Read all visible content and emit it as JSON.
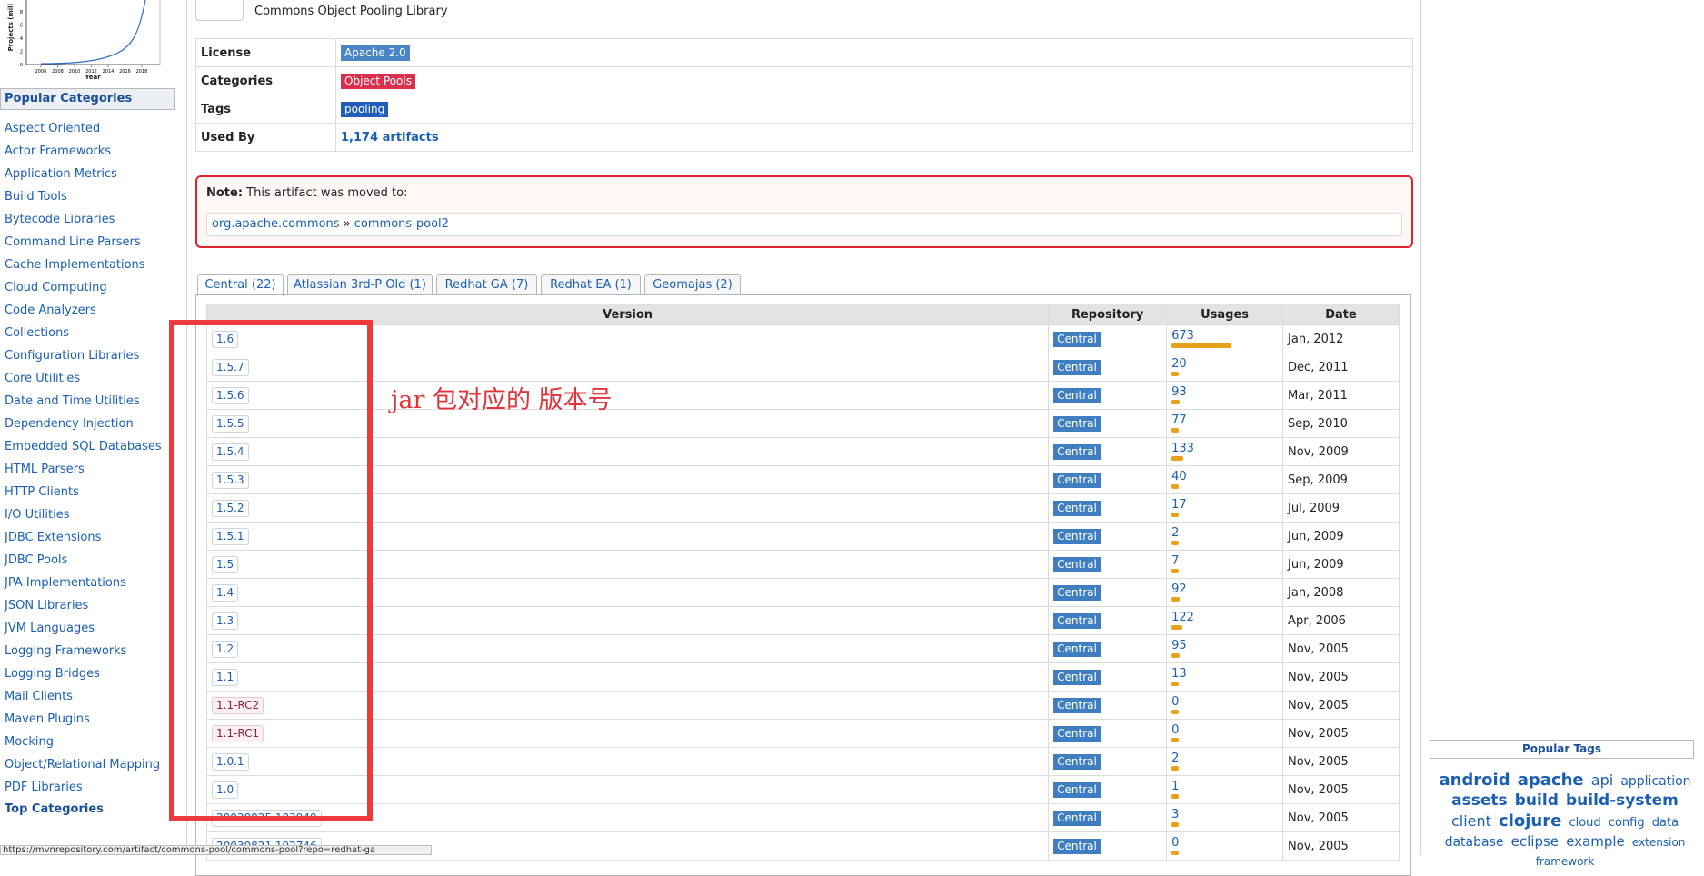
{
  "growth_chart": {
    "ylabel": "Projects (mill",
    "xlabel": "Year",
    "x_ticks": [
      "2006",
      "2008",
      "2010",
      "2012",
      "2014",
      "2016",
      "2018"
    ],
    "y_ticks": [
      "0",
      "2",
      "4",
      "6",
      "8"
    ]
  },
  "sidebar": {
    "popular_header": "Popular Categories",
    "categories": [
      "Aspect Oriented",
      "Actor Frameworks",
      "Application Metrics",
      "Build Tools",
      "Bytecode Libraries",
      "Command Line Parsers",
      "Cache Implementations",
      "Cloud Computing",
      "Code Analyzers",
      "Collections",
      "Configuration Libraries",
      "Core Utilities",
      "Date and Time Utilities",
      "Dependency Injection",
      "Embedded SQL Databases",
      "HTML Parsers",
      "HTTP Clients",
      "I/O Utilities",
      "JDBC Extensions",
      "JDBC Pools",
      "JPA Implementations",
      "JSON Libraries",
      "JVM Languages",
      "Logging Frameworks",
      "Logging Bridges",
      "Mail Clients",
      "Maven Plugins",
      "Mocking",
      "Object/Relational Mapping",
      "PDF Libraries"
    ],
    "top_categories": "Top Categories"
  },
  "artifact": {
    "description": "Commons Object Pooling Library",
    "license_key": "License",
    "license_value": "Apache 2.0",
    "categories_key": "Categories",
    "categories_value": "Object Pools",
    "tags_key": "Tags",
    "tags_value": "pooling",
    "used_by_key": "Used By",
    "used_by_value": "1,174 artifacts"
  },
  "note": {
    "label": "Note:",
    "text": " This artifact was moved to:",
    "group": "org.apache.commons",
    "separator": " » ",
    "artifact": "commons-pool2"
  },
  "tabs": [
    "Central (22)",
    "Atlassian 3rd-P Old (1)",
    "Redhat GA (7)",
    "Redhat EA (1)",
    "Geomajas (2)"
  ],
  "table": {
    "headers": [
      "Version",
      "Repository",
      "Usages",
      "Date"
    ],
    "rows": [
      {
        "version": "1.6",
        "repo": "Central",
        "usages": "673",
        "usage_value": 673,
        "date": "Jan, 2012",
        "pre": false
      },
      {
        "version": "1.5.7",
        "repo": "Central",
        "usages": "20",
        "usage_value": 20,
        "date": "Dec, 2011",
        "pre": false
      },
      {
        "version": "1.5.6",
        "repo": "Central",
        "usages": "93",
        "usage_value": 93,
        "date": "Mar, 2011",
        "pre": false
      },
      {
        "version": "1.5.5",
        "repo": "Central",
        "usages": "77",
        "usage_value": 77,
        "date": "Sep, 2010",
        "pre": false
      },
      {
        "version": "1.5.4",
        "repo": "Central",
        "usages": "133",
        "usage_value": 133,
        "date": "Nov, 2009",
        "pre": false
      },
      {
        "version": "1.5.3",
        "repo": "Central",
        "usages": "40",
        "usage_value": 40,
        "date": "Sep, 2009",
        "pre": false
      },
      {
        "version": "1.5.2",
        "repo": "Central",
        "usages": "17",
        "usage_value": 17,
        "date": "Jul, 2009",
        "pre": false
      },
      {
        "version": "1.5.1",
        "repo": "Central",
        "usages": "2",
        "usage_value": 2,
        "date": "Jun, 2009",
        "pre": false
      },
      {
        "version": "1.5",
        "repo": "Central",
        "usages": "7",
        "usage_value": 7,
        "date": "Jun, 2009",
        "pre": false
      },
      {
        "version": "1.4",
        "repo": "Central",
        "usages": "92",
        "usage_value": 92,
        "date": "Jan, 2008",
        "pre": false
      },
      {
        "version": "1.3",
        "repo": "Central",
        "usages": "122",
        "usage_value": 122,
        "date": "Apr, 2006",
        "pre": false
      },
      {
        "version": "1.2",
        "repo": "Central",
        "usages": "95",
        "usage_value": 95,
        "date": "Nov, 2005",
        "pre": false
      },
      {
        "version": "1.1",
        "repo": "Central",
        "usages": "13",
        "usage_value": 13,
        "date": "Nov, 2005",
        "pre": false
      },
      {
        "version": "1.1-RC2",
        "repo": "Central",
        "usages": "0",
        "usage_value": 0,
        "date": "Nov, 2005",
        "pre": true
      },
      {
        "version": "1.1-RC1",
        "repo": "Central",
        "usages": "0",
        "usage_value": 0,
        "date": "Nov, 2005",
        "pre": true
      },
      {
        "version": "1.0.1",
        "repo": "Central",
        "usages": "2",
        "usage_value": 2,
        "date": "Nov, 2005",
        "pre": false
      },
      {
        "version": "1.0",
        "repo": "Central",
        "usages": "1",
        "usage_value": 1,
        "date": "Nov, 2005",
        "pre": false
      },
      {
        "version": "20030825.183949",
        "repo": "Central",
        "usages": "3",
        "usage_value": 3,
        "date": "Nov, 2005",
        "pre": false
      },
      {
        "version": "20030821.192746",
        "repo": "Central",
        "usages": "0",
        "usage_value": 0,
        "date": "Nov, 2005",
        "pre": false
      }
    ]
  },
  "annotation": {
    "text": "jar  包对应的 版本号"
  },
  "popular_tags": {
    "header": "Popular Tags",
    "tags": [
      {
        "t": "android",
        "s": 18,
        "w": "bold"
      },
      {
        "t": "apache",
        "s": 18,
        "w": "bold"
      },
      {
        "t": "api",
        "s": 16,
        "w": "normal"
      },
      {
        "t": "application",
        "s": 14,
        "w": "normal"
      },
      {
        "t": "assets",
        "s": 17,
        "w": "bold"
      },
      {
        "t": "build",
        "s": 17,
        "w": "bold"
      },
      {
        "t": "build-system",
        "s": 17,
        "w": "bold"
      },
      {
        "t": "client",
        "s": 16,
        "w": "normal"
      },
      {
        "t": "clojure",
        "s": 18,
        "w": "bold"
      },
      {
        "t": "cloud",
        "s": 13,
        "w": "normal"
      },
      {
        "t": "config",
        "s": 13,
        "w": "normal"
      },
      {
        "t": "data",
        "s": 13,
        "w": "normal"
      },
      {
        "t": "database",
        "s": 14,
        "w": "normal"
      },
      {
        "t": "eclipse",
        "s": 15,
        "w": "normal"
      },
      {
        "t": "example",
        "s": 15,
        "w": "normal"
      },
      {
        "t": "extension",
        "s": 12,
        "w": "normal"
      },
      {
        "t": "framework",
        "s": 12,
        "w": "normal"
      }
    ]
  },
  "status_bar": {
    "url": "https://mvnrepository.com/artifact/commons-pool/commons-pool?repo=redhat-ga"
  },
  "colors": {
    "license_label": "#4a86c6",
    "category_label": "#d9304d",
    "tag_label": "#1f5fb8",
    "annotation": "#ee3a3a",
    "usage_bar": "#e8a21a",
    "note_border": "#e0242e"
  }
}
